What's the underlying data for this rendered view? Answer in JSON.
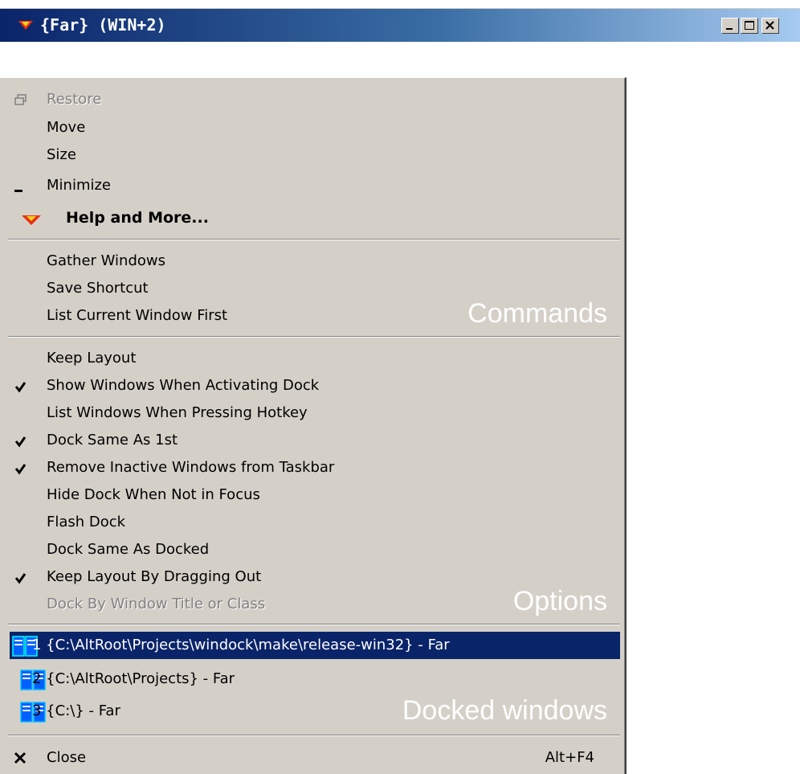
{
  "window": {
    "title": "{Far} (WIN+2)",
    "buttons": [
      "minimize-icon",
      "maximize-icon",
      "close-icon"
    ]
  },
  "menu": {
    "system_items": [
      {
        "label": "Restore",
        "enabled": false,
        "icon": "restore-icon"
      },
      {
        "label": "Move",
        "enabled": true
      },
      {
        "label": "Size",
        "enabled": true
      },
      {
        "label": "Minimize",
        "enabled": true,
        "icon": "minimize-icon"
      },
      {
        "label": "Help and More...",
        "enabled": true,
        "bold": true,
        "icon": "windock-logo-icon"
      }
    ],
    "commands": {
      "group_label": "Commands",
      "items": [
        {
          "label": "Gather Windows"
        },
        {
          "label": "Save Shortcut"
        },
        {
          "label": "List Current Window First"
        }
      ]
    },
    "options": {
      "group_label": "Options",
      "items": [
        {
          "label": "Keep Layout",
          "checked": false
        },
        {
          "label": "Show Windows When Activating Dock",
          "checked": true
        },
        {
          "label": "List Windows When Pressing Hotkey",
          "checked": false
        },
        {
          "label": "Dock Same As 1st",
          "checked": true
        },
        {
          "label": "Remove Inactive Windows from Taskbar",
          "checked": true
        },
        {
          "label": "Hide Dock When Not in Focus",
          "checked": false
        },
        {
          "label": "Flash Dock",
          "checked": false
        },
        {
          "label": "Dock Same As Docked",
          "checked": false
        },
        {
          "label": "Keep Layout By Dragging Out",
          "checked": true
        },
        {
          "label": "Dock By Window Title or Class",
          "checked": false,
          "enabled": false
        }
      ]
    },
    "docked_windows": {
      "group_label": "Docked windows",
      "items": [
        {
          "label": "1 {C:\\AltRoot\\Projects\\windock\\make\\release-win32} - Far",
          "selected": true
        },
        {
          "label": "2 {C:\\AltRoot\\Projects} - Far",
          "selected": false
        },
        {
          "label": "3 {C:\\} - Far",
          "selected": false
        }
      ]
    },
    "close": {
      "label": "Close",
      "shortcut": "Alt+F4",
      "icon": "close-x-icon"
    }
  },
  "colors": {
    "menu_bg": "#d4d0c8",
    "selection": "#0a246a",
    "titlebar_start": "#0a246a",
    "titlebar_end": "#a6caf0"
  }
}
